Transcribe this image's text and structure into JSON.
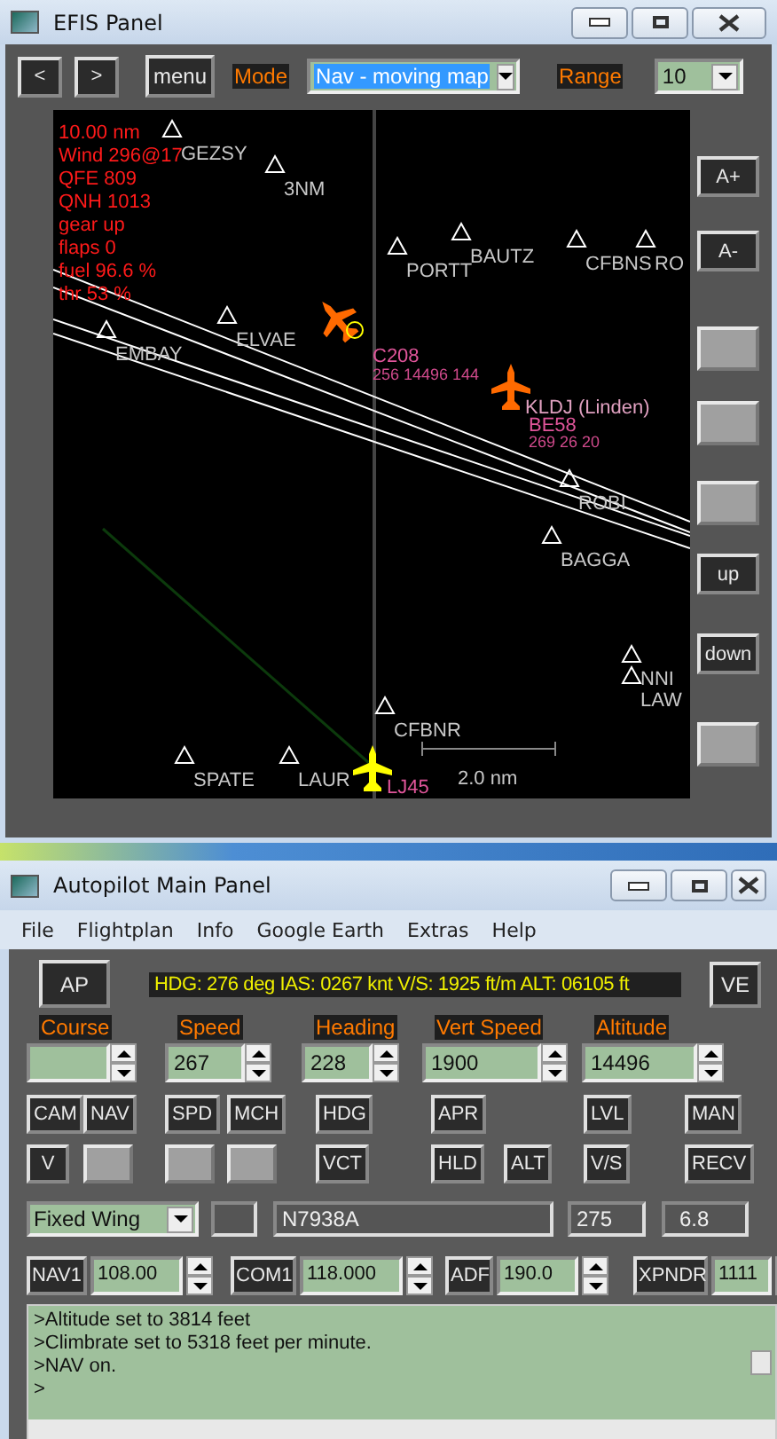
{
  "efis_window": {
    "title": "EFIS Panel",
    "toolbar": {
      "buttons": [
        "<",
        ">",
        "menu"
      ],
      "mode_label": "Mode",
      "mode_value": "Nav - moving map",
      "range_label": "Range",
      "range_value": "10"
    },
    "map": {
      "info_lines": [
        "10.00 nm",
        "Wind 296@17",
        "QFE 809",
        "QNH 1013",
        "gear up",
        "flaps 0",
        "fuel 96.6 %",
        "thr 53 %"
      ],
      "waypoints": [
        {
          "label": "GEZSY"
        },
        {
          "label": "3NM"
        },
        {
          "label": "PORTT"
        },
        {
          "label": "BAUTZ"
        },
        {
          "label": "CFBNS"
        },
        {
          "label": "RO"
        },
        {
          "label": "ELVAE"
        },
        {
          "label": "EMBAY"
        },
        {
          "label": "ROBI"
        },
        {
          "label": "BAGGA"
        },
        {
          "label": "NNI"
        },
        {
          "label": "LAW"
        },
        {
          "label": "CFBNR"
        },
        {
          "label": "SPATE"
        },
        {
          "label": "LAUR"
        }
      ],
      "aircraft": [
        {
          "type": "C208",
          "details": "256 14496 144",
          "color": "#ff6a00"
        },
        {
          "airport": "KLDJ (Linden)",
          "type": "BE58",
          "details": "269  26  20",
          "color": "#ff6a00"
        },
        {
          "type": "LJ45",
          "color": "#ffff00"
        }
      ],
      "scale": "2.0 nm"
    },
    "side_buttons": [
      {
        "kind": "text",
        "label": "A+"
      },
      {
        "kind": "text",
        "label": "A-"
      },
      {
        "kind": "blank"
      },
      {
        "kind": "blank"
      },
      {
        "kind": "blank"
      },
      {
        "kind": "text",
        "label": "up"
      },
      {
        "kind": "text",
        "label": "down"
      },
      {
        "kind": "blank"
      }
    ]
  },
  "autopilot_window": {
    "title": "Autopilot Main Panel",
    "menu": [
      "File",
      "Flightplan",
      "Info",
      "Google Earth",
      "Extras",
      "Help"
    ],
    "ap_button": "AP",
    "status": "HDG: 276 deg IAS: 0267 knt V/S: 1925 ft/m ALT: 06105 ft",
    "ve_button": "VE",
    "settings": [
      {
        "label": "Course"
      },
      {
        "label": "Speed",
        "value": "267"
      },
      {
        "label": "Heading",
        "value": "228"
      },
      {
        "label": "Vert Speed",
        "value": "1900"
      },
      {
        "label": "Altitude",
        "value": "14496"
      }
    ],
    "mode_buttons_row_1": [
      {
        "kind": "text",
        "label": "CAM"
      },
      {
        "kind": "text",
        "label": "NAV"
      },
      {
        "kind": "text",
        "label": "SPD"
      },
      {
        "kind": "text",
        "label": "MCH"
      },
      {
        "kind": "text",
        "label": "HDG"
      },
      {
        "kind": "text",
        "label": "APR"
      },
      {
        "kind": "text",
        "label": "LVL"
      },
      {
        "kind": "text",
        "label": "MAN"
      }
    ],
    "mode_buttons_row_2": [
      {
        "kind": "text",
        "label": "V"
      },
      {
        "kind": "blank"
      },
      {
        "kind": "blank"
      },
      {
        "kind": "blank"
      },
      {
        "kind": "text",
        "label": "VCT"
      },
      {
        "kind": "text",
        "label": "HLD"
      },
      {
        "kind": "text",
        "label": "ALT"
      },
      {
        "kind": "text",
        "label": "V/S"
      },
      {
        "kind": "text",
        "label": "RECV"
      }
    ],
    "aircraft_type": "Fixed Wing",
    "registration": "N7938A",
    "field_1": "275",
    "field_2": "6.8",
    "radios": [
      {
        "label": "NAV1",
        "value": "108.00"
      },
      {
        "label": "COM1",
        "value": "118.000"
      },
      {
        "label": "ADF",
        "value": "190.0"
      },
      {
        "label": "XPNDR",
        "value": "1111"
      }
    ],
    "log": [
      ">Altitude set to 3814 feet",
      ">Climbrate set to 5318 feet per minute.",
      ">NAV on.",
      ">"
    ]
  }
}
